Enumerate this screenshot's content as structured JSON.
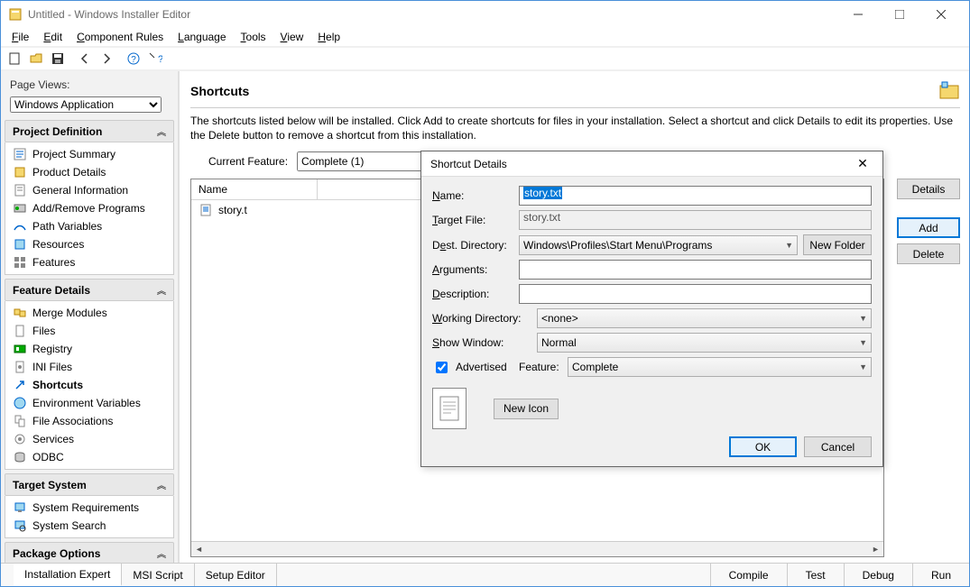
{
  "window": {
    "title": "Untitled - Windows Installer Editor"
  },
  "menu": {
    "file": "File",
    "edit": "Edit",
    "component_rules": "Component Rules",
    "language": "Language",
    "tools": "Tools",
    "view": "View",
    "help": "Help"
  },
  "sidebar": {
    "label": "Page Views:",
    "view_select": "Windows Application",
    "project_definition": {
      "title": "Project Definition",
      "items": [
        "Project Summary",
        "Product Details",
        "General Information",
        "Add/Remove Programs",
        "Path Variables",
        "Resources",
        "Features"
      ]
    },
    "feature_details": {
      "title": "Feature Details",
      "items": [
        "Merge Modules",
        "Files",
        "Registry",
        "INI Files",
        "Shortcuts",
        "Environment Variables",
        "File Associations",
        "Services",
        "ODBC"
      ]
    },
    "target_system": {
      "title": "Target System",
      "items": [
        "System Requirements",
        "System Search"
      ]
    },
    "package_options": {
      "title": "Package Options"
    }
  },
  "content": {
    "heading": "Shortcuts",
    "description": "The shortcuts listed below will be installed. Click Add to create shortcuts for files in your installation. Select a shortcut and click Details to edit its properties. Use the Delete button to remove a shortcut from this installation.",
    "feature_label": "Current Feature:",
    "feature_value": "Complete  (1)",
    "table": {
      "cols": [
        "Name",
        ""
      ],
      "rows": [
        {
          "name": "story.t"
        }
      ]
    },
    "buttons": {
      "details": "Details",
      "add": "Add",
      "delete": "Delete"
    }
  },
  "dialog": {
    "title": "Shortcut Details",
    "name_label": "Name:",
    "name_value": "story.txt",
    "target_label": "Target File:",
    "target_value": "story.txt",
    "dest_label": "Dest. Directory:",
    "dest_value": "Windows\\Profiles\\Start Menu\\Programs",
    "new_folder": "New Folder",
    "args_label": "Arguments:",
    "args_value": "",
    "desc_label": "Description:",
    "desc_value": "",
    "workdir_label": "Working Directory:",
    "workdir_value": "<none>",
    "show_label": "Show Window:",
    "show_value": "Normal",
    "advertised_label": "Advertised",
    "advertised_checked": true,
    "feature_label": "Feature:",
    "feature_value": "Complete",
    "new_icon": "New Icon",
    "ok": "OK",
    "cancel": "Cancel"
  },
  "tabs": {
    "left": [
      "Installation Expert",
      "MSI Script",
      "Setup Editor"
    ],
    "right": [
      "Compile",
      "Test",
      "Debug",
      "Run"
    ]
  }
}
